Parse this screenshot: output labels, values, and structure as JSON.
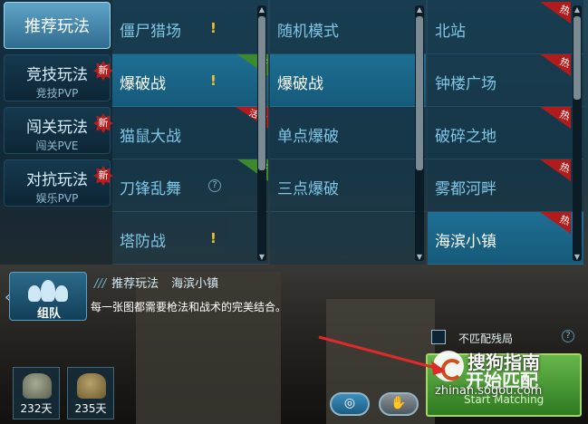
{
  "categories": [
    {
      "main": "推荐玩法",
      "sub": "",
      "active": true,
      "new": false
    },
    {
      "main": "竞技玩法",
      "sub": "竞技PVP",
      "active": false,
      "new": true
    },
    {
      "main": "闯关玩法",
      "sub": "闯关PVE",
      "active": false,
      "new": true
    },
    {
      "main": "对抗玩法",
      "sub": "娱乐PVP",
      "active": false,
      "new": true
    }
  ],
  "badges": {
    "new": "新",
    "hot": "热",
    "event": "活动",
    "warn": "!",
    "help": "?"
  },
  "modes_col1": [
    "僵尸猎场",
    "爆破战",
    "猫鼠大战",
    "刀锋乱舞",
    "塔防战"
  ],
  "modes_col2": [
    "随机模式",
    "爆破战",
    "单点爆破",
    "三点爆破"
  ],
  "maps_col3": [
    "北站",
    "钟楼广场",
    "破碎之地",
    "雾都河畔",
    "海滨小镇"
  ],
  "breadcrumb": {
    "mode": "推荐玩法",
    "map": "海滨小镇",
    "slashes": "///"
  },
  "description": "每一张图都需要枪法和战术的完美结合。",
  "team_button": {
    "label": "组队"
  },
  "inventory": [
    {
      "days": "232天"
    },
    {
      "days": "235天"
    }
  ],
  "options": {
    "no_bots_label": "不匹配残局",
    "no_bots_checked": false
  },
  "start_button": {
    "label_cn": "开始匹配",
    "label_en": "Start Matching"
  },
  "watermark": {
    "title": "搜狗指南",
    "url": "zhinan.sogou.com"
  },
  "colors": {
    "accent": "#1e6f94",
    "start_green": "#4c9a38",
    "hot_red": "#b01b1b",
    "new_green": "#3d8a2e",
    "warn_yellow": "#f2c230"
  }
}
